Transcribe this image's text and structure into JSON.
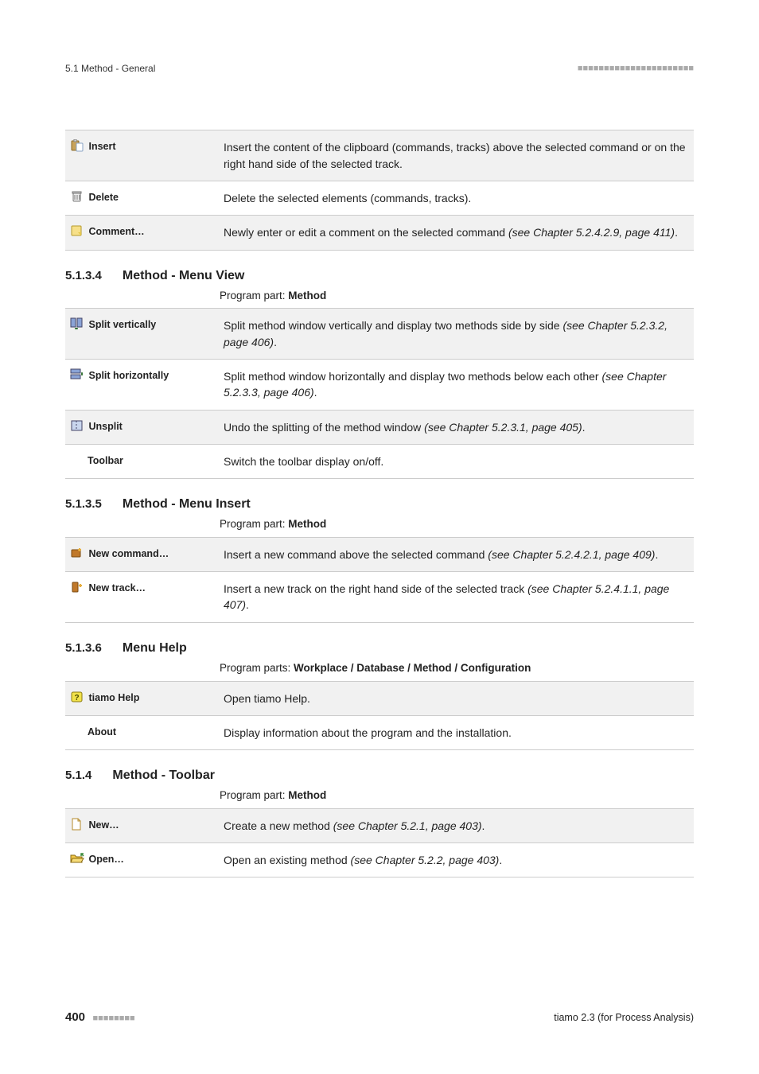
{
  "header": {
    "left": "5.1 Method - General",
    "dots": "■■■■■■■■■■■■■■■■■■■■■■"
  },
  "table_edit": {
    "rows": [
      {
        "label": "Insert",
        "desc": "Insert the content of the clipboard (commands, tracks) above the selected command or on the right hand side of the selected track."
      },
      {
        "label": "Delete",
        "desc": "Delete the selected elements (commands, tracks)."
      },
      {
        "label": "Comment…",
        "desc_pre": "Newly enter or edit a comment on the selected command ",
        "desc_ital": "(see Chapter 5.2.4.2.9, page 411)",
        "desc_post": "."
      }
    ]
  },
  "sec_view": {
    "num": "5.1.3.4",
    "title": "Method - Menu View",
    "program_part_pre": "Program part: ",
    "program_part_b": "Method",
    "rows": [
      {
        "label": "Split vertically",
        "desc_pre": "Split method window vertically and display two methods side by side ",
        "desc_ital": "(see Chapter 5.2.3.2, page 406)",
        "desc_post": "."
      },
      {
        "label": "Split horizontally",
        "desc_pre": "Split method window horizontally and display two methods below each other ",
        "desc_ital": "(see Chapter 5.2.3.3, page 406)",
        "desc_post": "."
      },
      {
        "label": "Unsplit",
        "desc_pre": "Undo the splitting of the method window ",
        "desc_ital": "(see Chapter 5.2.3.1, page 405)",
        "desc_post": "."
      },
      {
        "label": "Toolbar",
        "desc": "Switch the toolbar display on/off."
      }
    ]
  },
  "sec_insert": {
    "num": "5.1.3.5",
    "title": "Method - Menu Insert",
    "program_part_pre": "Program part: ",
    "program_part_b": "Method",
    "rows": [
      {
        "label": "New command…",
        "desc_pre": "Insert a new command above the selected command ",
        "desc_ital": "(see Chapter 5.2.4.2.1, page 409)",
        "desc_post": "."
      },
      {
        "label": "New track…",
        "desc_pre": "Insert a new track on the right hand side of the selected track ",
        "desc_ital": "(see Chapter 5.2.4.1.1, page 407)",
        "desc_post": "."
      }
    ]
  },
  "sec_help": {
    "num": "5.1.3.6",
    "title": "Menu Help",
    "program_part_pre": "Program parts: ",
    "program_part_b": "Workplace / Database / Method / Configuration",
    "rows": [
      {
        "label": "tiamo Help",
        "desc": "Open tiamo Help."
      },
      {
        "label": "About",
        "desc": "Display information about the program and the installation."
      }
    ]
  },
  "sec_toolbar": {
    "num": "5.1.4",
    "title": "Method - Toolbar",
    "program_part_pre": "Program part: ",
    "program_part_b": "Method",
    "rows": [
      {
        "label": "New…",
        "desc_pre": "Create a new method ",
        "desc_ital": "(see Chapter 5.2.1, page 403)",
        "desc_post": "."
      },
      {
        "label": "Open…",
        "desc_pre": "Open an existing method ",
        "desc_ital": "(see Chapter 5.2.2, page 403)",
        "desc_post": "."
      }
    ]
  },
  "footer": {
    "page": "400",
    "dots": "■■■■■■■■",
    "right": "tiamo 2.3 (for Process Analysis)"
  }
}
